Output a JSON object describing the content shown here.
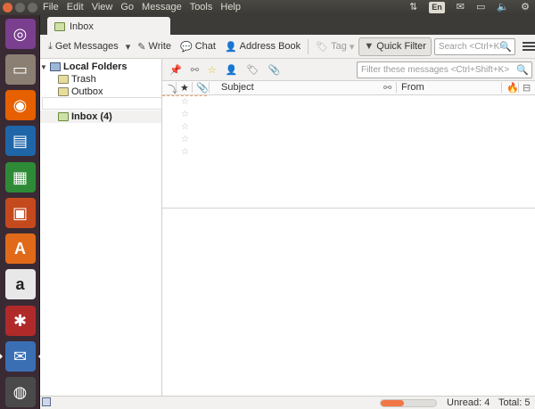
{
  "top_panel": {
    "menu": [
      "File",
      "Edit",
      "View",
      "Go",
      "Message",
      "Tools",
      "Help"
    ],
    "indicators": {
      "network": "⇅",
      "language": "En",
      "mail": "✉",
      "battery": "▭",
      "volume": "🔈",
      "gear": "⚙"
    }
  },
  "launcher": {
    "items": [
      {
        "name": "ubuntu-dash",
        "glyph": "◎",
        "color": "#7a3f8f"
      },
      {
        "name": "files",
        "glyph": "▭",
        "color": "#8a7f72"
      },
      {
        "name": "firefox",
        "glyph": "◉",
        "color": "#e66000"
      },
      {
        "name": "libreoffice-writer",
        "glyph": "▤",
        "color": "#1f66a8"
      },
      {
        "name": "libreoffice-calc",
        "glyph": "▦",
        "color": "#2e8a36"
      },
      {
        "name": "libreoffice-impress",
        "glyph": "▣",
        "color": "#c44a1e"
      },
      {
        "name": "software-center",
        "glyph": "A",
        "color": "#e06a1a"
      },
      {
        "name": "amazon",
        "glyph": "a",
        "color": "#e8e8e8"
      },
      {
        "name": "system-settings",
        "glyph": "✱",
        "color": "#b02a2a"
      },
      {
        "name": "thunderbird",
        "glyph": "✉",
        "color": "#3a6fb4"
      },
      {
        "name": "trash",
        "glyph": "◍",
        "color": "#4a4a4a"
      }
    ]
  },
  "tab": {
    "label": "Inbox"
  },
  "toolbar": {
    "get_messages": "Get Messages",
    "write": "Write",
    "chat": "Chat",
    "address_book": "Address Book",
    "tag": "Tag",
    "quick_filter": "Quick Filter",
    "search_placeholder": "Search <Ctrl+K>"
  },
  "folders": {
    "root": "Local Folders",
    "items": [
      {
        "label": "Trash"
      },
      {
        "label": "Outbox"
      }
    ],
    "selected": "Inbox (4)"
  },
  "message_list": {
    "filter_placeholder": "Filter these messages <Ctrl+Shift+K>",
    "columns": {
      "subject": "Subject",
      "from": "From"
    },
    "rows": [
      {
        "starred": false
      },
      {
        "starred": false
      },
      {
        "starred": false
      },
      {
        "starred": false
      },
      {
        "starred": false
      }
    ]
  },
  "status_bar": {
    "progress": 0.42,
    "unread": "Unread: 4",
    "total": "Total: 5"
  },
  "colors": {
    "accent": "#f07746",
    "panel": "#3c3b37",
    "launcher": "#3a2a34"
  }
}
